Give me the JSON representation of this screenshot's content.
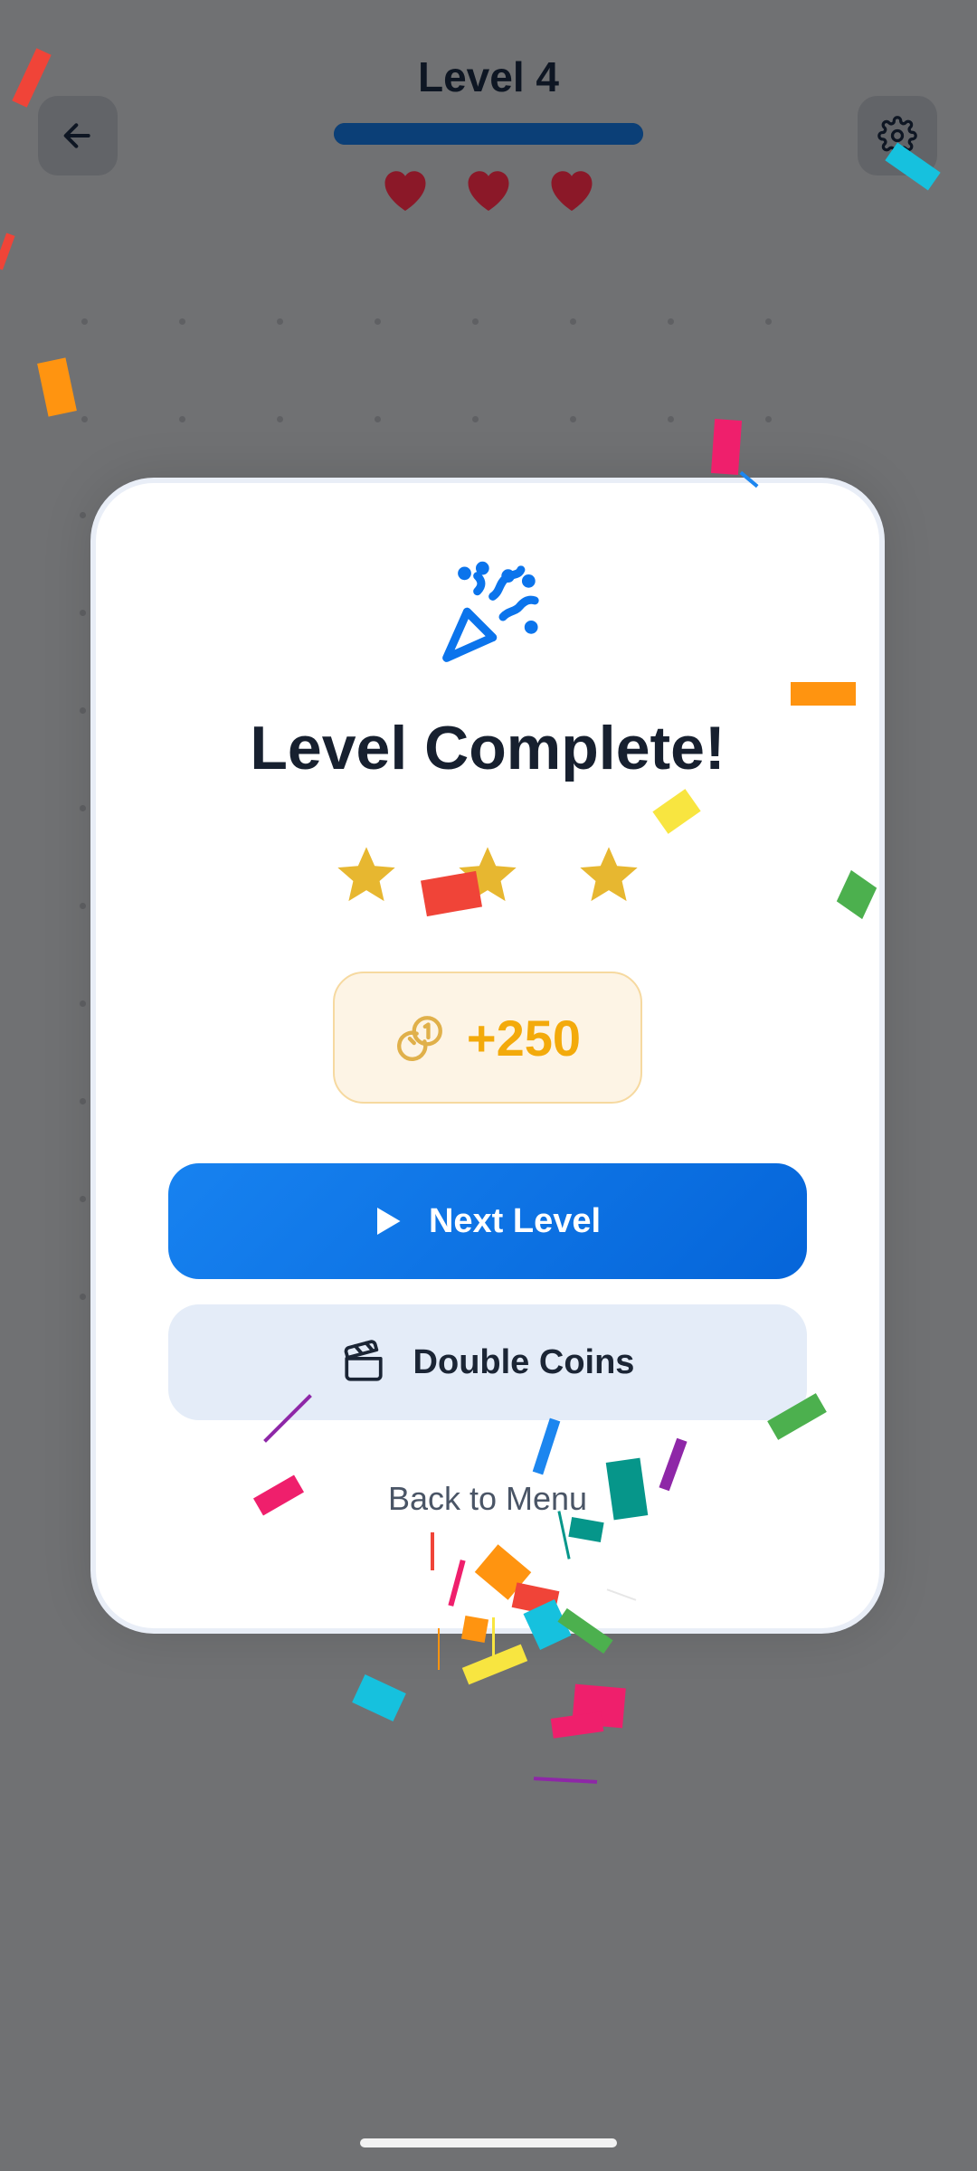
{
  "header": {
    "back_icon": "arrow-left-icon",
    "level_title": "Level 4",
    "progress": 1.0,
    "hearts": [
      {
        "icon": "heart-icon",
        "color": "#8b1828"
      },
      {
        "icon": "heart-icon",
        "color": "#8b1828"
      },
      {
        "icon": "heart-icon",
        "color": "#8b1828"
      }
    ],
    "settings_icon": "gear-icon"
  },
  "modal": {
    "celebration_icon": "party-popper-icon",
    "title": "Level Complete!",
    "stars": [
      {
        "icon": "star-icon",
        "filled": true,
        "color": "#e7b730"
      },
      {
        "icon": "star-icon",
        "filled": true,
        "color": "#e7b730"
      },
      {
        "icon": "star-icon",
        "filled": true,
        "color": "#e7b730"
      }
    ],
    "reward": {
      "icon": "coins-icon",
      "amount": "+250",
      "color": "#f3aa0b"
    },
    "next_button": {
      "icon": "play-icon",
      "label": "Next Level"
    },
    "double_button": {
      "icon": "clapperboard-icon",
      "label": "Double Coins"
    },
    "back_link": "Back to Menu"
  },
  "colors": {
    "accent": "#0b74ec",
    "overlay": "#707173",
    "title_text": "#17202f"
  }
}
